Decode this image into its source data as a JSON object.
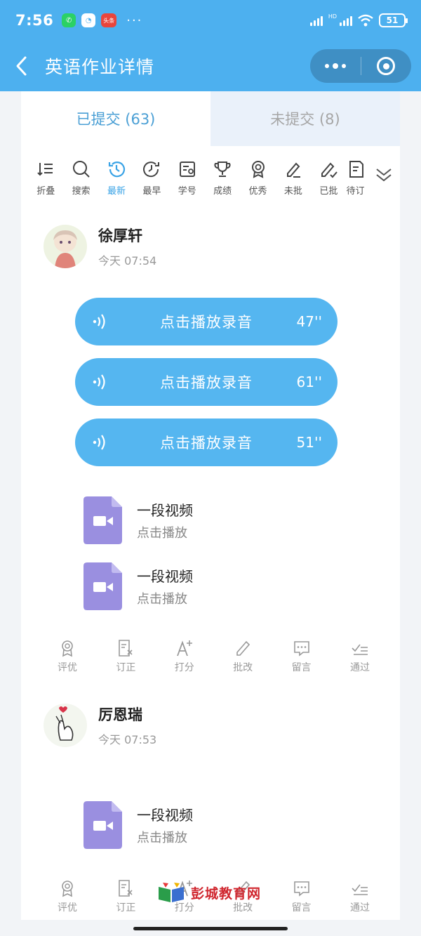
{
  "status_bar": {
    "time": "7:56",
    "apps": [
      "wechat",
      "message",
      "头条"
    ],
    "more": "···",
    "battery": "51"
  },
  "nav": {
    "title": "英语作业详情"
  },
  "tabs": [
    {
      "label": "已提交 (63)",
      "active": true
    },
    {
      "label": "未提交 (8)",
      "active": false
    }
  ],
  "toolbar": [
    {
      "label": "折叠",
      "icon": "collapse-icon"
    },
    {
      "label": "搜索",
      "icon": "search-icon"
    },
    {
      "label": "最新",
      "icon": "latest-clock-icon",
      "active": true
    },
    {
      "label": "最早",
      "icon": "earliest-clock-icon"
    },
    {
      "label": "学号",
      "icon": "student-id-icon"
    },
    {
      "label": "成绩",
      "icon": "trophy-icon"
    },
    {
      "label": "优秀",
      "icon": "medal-icon"
    },
    {
      "label": "未批",
      "icon": "pen-icon"
    },
    {
      "label": "已批",
      "icon": "pen-check-icon"
    },
    {
      "label": "待订",
      "icon": "doc-edit-icon"
    }
  ],
  "submissions": [
    {
      "name": "徐厚轩",
      "time": "今天 07:54",
      "audios": [
        {
          "label": "点击播放录音",
          "duration": "47''"
        },
        {
          "label": "点击播放录音",
          "duration": "61''"
        },
        {
          "label": "点击播放录音",
          "duration": "51''"
        }
      ],
      "videos": [
        {
          "title": "一段视频",
          "subtitle": "点击播放"
        },
        {
          "title": "一段视频",
          "subtitle": "点击播放"
        }
      ]
    },
    {
      "name": "厉恩瑞",
      "time": "今天 07:53",
      "videos": [
        {
          "title": "一段视频",
          "subtitle": "点击播放"
        }
      ]
    }
  ],
  "actions": [
    "评优",
    "订正",
    "打分",
    "批改",
    "留言",
    "通过"
  ],
  "watermark": "彭城教育网",
  "colors": {
    "primary": "#4db0ef",
    "audio_button": "#55b6f0",
    "video_icon": "#9a8fe0",
    "active_tab": "#4a9fd5"
  }
}
